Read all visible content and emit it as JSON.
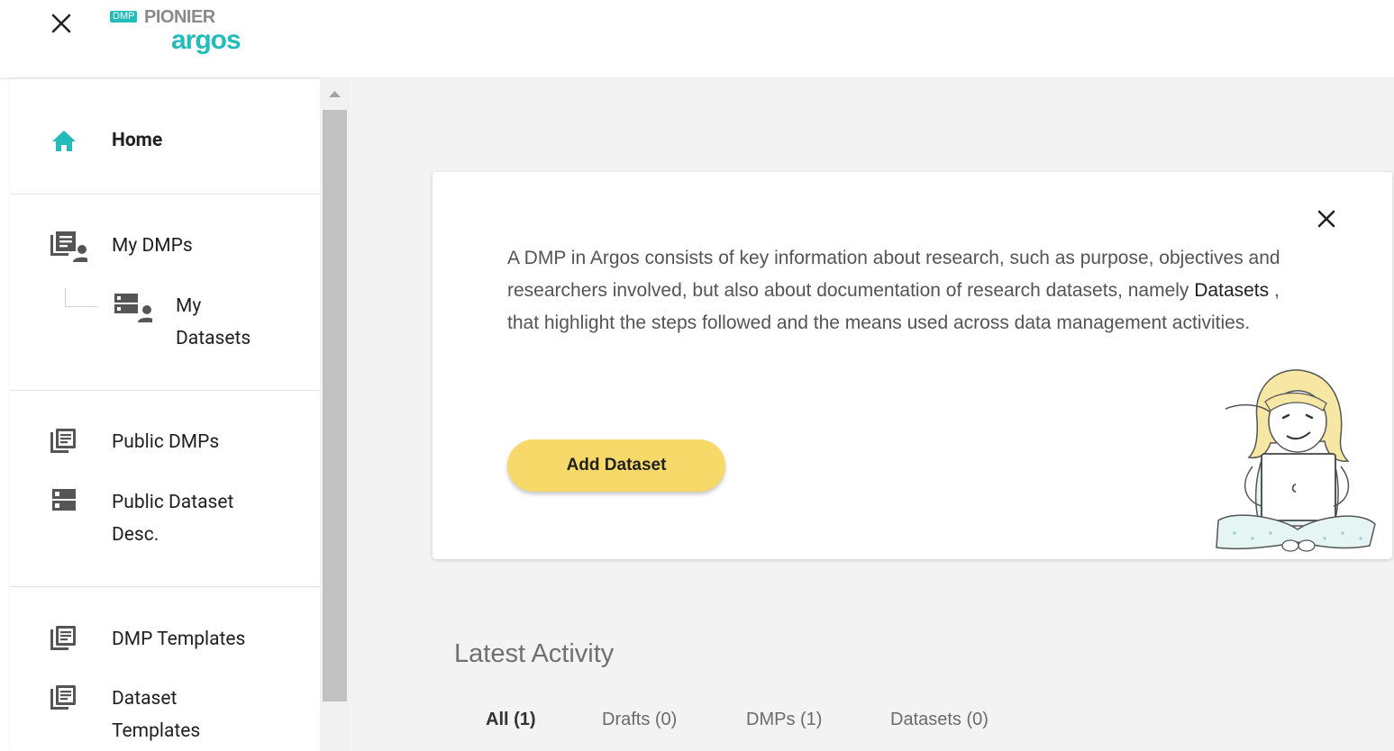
{
  "header": {
    "logo_badge": "DMP",
    "logo_name": "PIONIER",
    "logo_product": "argos"
  },
  "sidebar": {
    "items": [
      {
        "label": "Home",
        "icon": "home-icon",
        "active": true
      },
      {
        "label": "My DMPs",
        "icon": "dmp-user-icon"
      },
      {
        "label": "My",
        "label2": "Datasets",
        "icon": "dataset-user-icon"
      },
      {
        "label": "Public DMPs",
        "icon": "library-books-icon"
      },
      {
        "label": "Public Dataset",
        "label2": "Desc.",
        "icon": "storage-icon"
      },
      {
        "label": "DMP Templates",
        "icon": "library-books-icon"
      },
      {
        "label": "Dataset",
        "label2": "Templates",
        "icon": "library-books-icon"
      }
    ]
  },
  "info_card": {
    "text_before": "A DMP in Argos consists of key information about research, such as purpose, objectives and researchers involved, but also about documentation of research datasets, namely ",
    "text_bold": "Datasets",
    "text_after": " , that highlight the steps followed and the means used across data management activities.",
    "button_label": "Add Dataset"
  },
  "latest_activity": {
    "title": "Latest Activity",
    "tabs": [
      "All (1)",
      "Drafts (0)",
      "DMPs (1)",
      "Datasets (0)"
    ]
  },
  "colors": {
    "accent": "#23bcba",
    "button": "#f7d96a",
    "main_bg": "#f3f3f3"
  }
}
